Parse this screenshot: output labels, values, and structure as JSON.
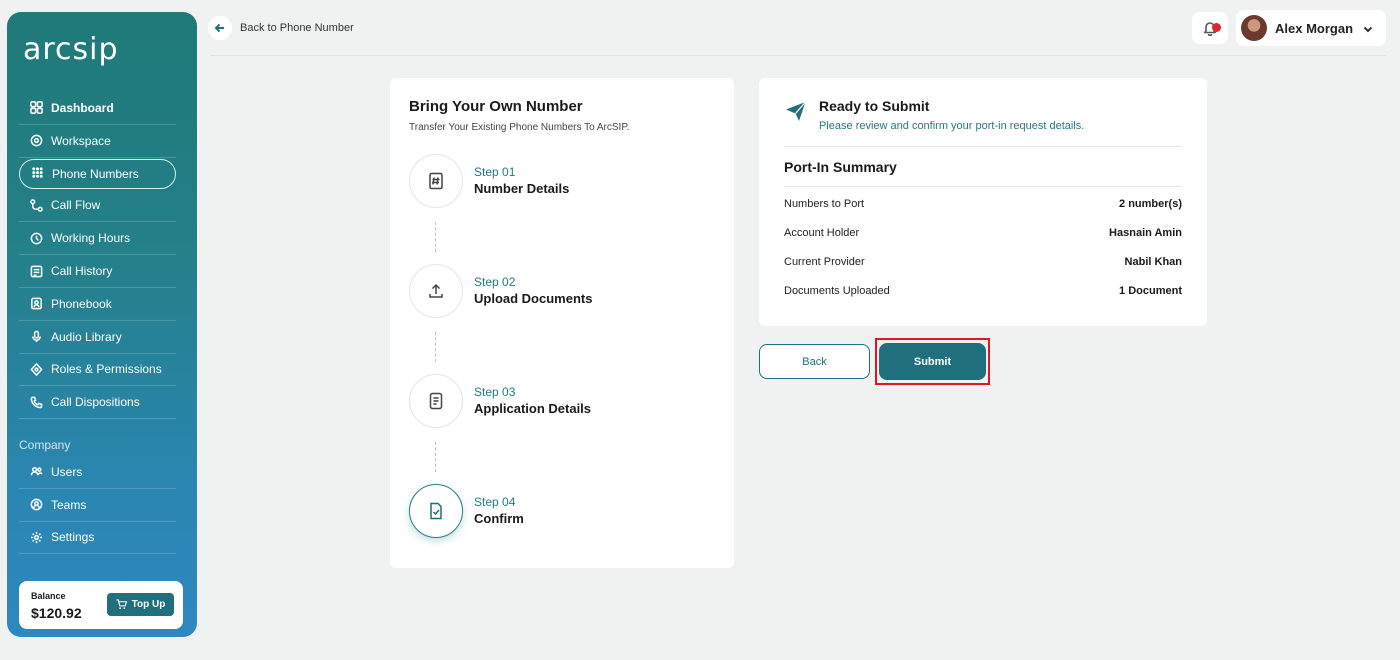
{
  "brand": {
    "logo_text": "arcsip"
  },
  "sidebar": {
    "items": [
      {
        "label": "Dashboard",
        "icon": "grid-icon"
      },
      {
        "label": "Workspace",
        "icon": "workspace-icon"
      },
      {
        "label": "Phone Numbers",
        "icon": "dialpad-icon"
      },
      {
        "label": "Call Flow",
        "icon": "flow-icon"
      },
      {
        "label": "Working Hours",
        "icon": "clock-icon"
      },
      {
        "label": "Call History",
        "icon": "history-icon"
      },
      {
        "label": "Phonebook",
        "icon": "phonebook-icon"
      },
      {
        "label": "Audio Library",
        "icon": "mic-icon"
      },
      {
        "label": "Roles & Permissions",
        "icon": "roles-icon"
      },
      {
        "label": "Call Dispositions",
        "icon": "phone-icon"
      }
    ],
    "company_label": "Company",
    "company_items": [
      {
        "label": "Users",
        "icon": "users-icon"
      },
      {
        "label": "Teams",
        "icon": "teams-icon"
      },
      {
        "label": "Settings",
        "icon": "settings-icon"
      }
    ],
    "balance": {
      "label": "Balance",
      "amount": "$120.92",
      "topup_label": "Top Up"
    }
  },
  "header": {
    "back_label": "Back to Phone Number",
    "user_name": "Alex Morgan"
  },
  "steps": {
    "title": "Bring Your Own Number",
    "subtitle": "Transfer Your Existing Phone Numbers To ArcSIP.",
    "items": [
      {
        "num": "Step 01",
        "name": "Number Details"
      },
      {
        "num": "Step 02",
        "name": "Upload Documents"
      },
      {
        "num": "Step 03",
        "name": "Application Details"
      },
      {
        "num": "Step 04",
        "name": "Confirm"
      }
    ]
  },
  "summary": {
    "ready_title": "Ready to Submit",
    "ready_sub": "Please review and confirm your port-in request details.",
    "title": "Port-In Summary",
    "rows": [
      {
        "key": "Numbers to Port",
        "value": "2 number(s)"
      },
      {
        "key": "Account Holder",
        "value": "Hasnain Amin"
      },
      {
        "key": "Current Provider",
        "value": "Nabil Khan"
      },
      {
        "key": "Documents Uploaded",
        "value": "1 Document"
      }
    ]
  },
  "actions": {
    "back_label": "Back",
    "submit_label": "Submit"
  },
  "colors": {
    "accent": "#1f6f7c",
    "highlight": "#e0171f",
    "notification": "#e0262b"
  }
}
